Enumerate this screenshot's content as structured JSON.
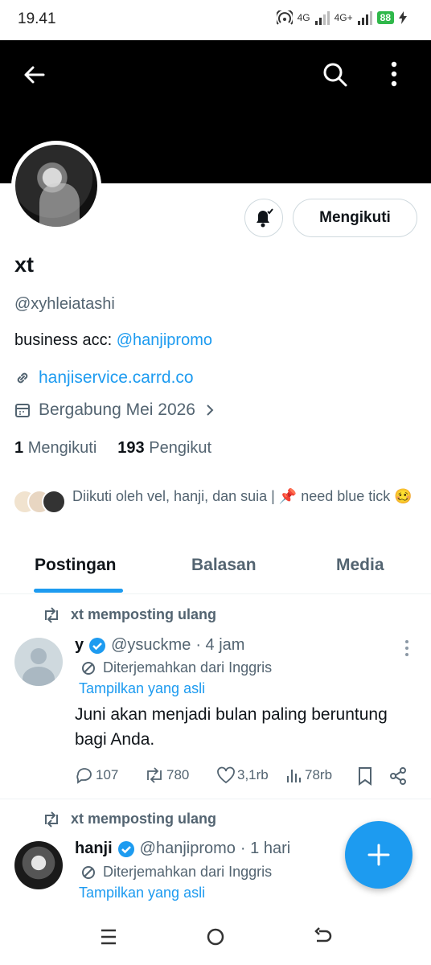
{
  "status_bar": {
    "time": "19.41",
    "net1": "4G",
    "net2": "4G+",
    "battery": "88"
  },
  "header": {
    "back_icon": "arrow-left-icon",
    "search_icon": "search-icon",
    "more_icon": "more-vertical-icon"
  },
  "profile": {
    "name": "xt",
    "handle": "@xyhleiatashi",
    "bio_prefix": "business acc: ",
    "bio_link": "@hanjipromo",
    "website": "hanjiservice.carrd.co",
    "joined": "Bergabung Mei 2026",
    "following_count": "1",
    "following_label": "Mengikuti",
    "followers_count": "193",
    "followers_label": "Pengikut",
    "followed_by": "Diikuti oleh vel, hanji, dan suia | 📌 need blue tick 🥴",
    "follow_button": "Mengikuti"
  },
  "tabs": [
    "Postingan",
    "Balasan",
    "Media"
  ],
  "posts": [
    {
      "repost_label": "xt memposting ulang",
      "name": "y",
      "handle": "@ysuckme",
      "time": "· 4 jam",
      "translated": "Diterjemahkan dari Inggris",
      "show_original": "Tampilkan yang asli",
      "text": "Juni akan menjadi bulan paling beruntung bagi Anda.",
      "replies": "107",
      "reposts": "780",
      "likes": "3,1rb",
      "views": "78rb"
    },
    {
      "repost_label": "xt memposting ulang",
      "name": "hanji",
      "handle": "@hanjipromo",
      "time": "· 1 hari",
      "translated": "Diterjemahkan dari Inggris",
      "show_original": "Tampilkan yang asli"
    }
  ],
  "colors": {
    "accent": "#1d9bf0",
    "text": "#0f1419",
    "secondary": "#536471",
    "verified": "#1d9bf0"
  }
}
